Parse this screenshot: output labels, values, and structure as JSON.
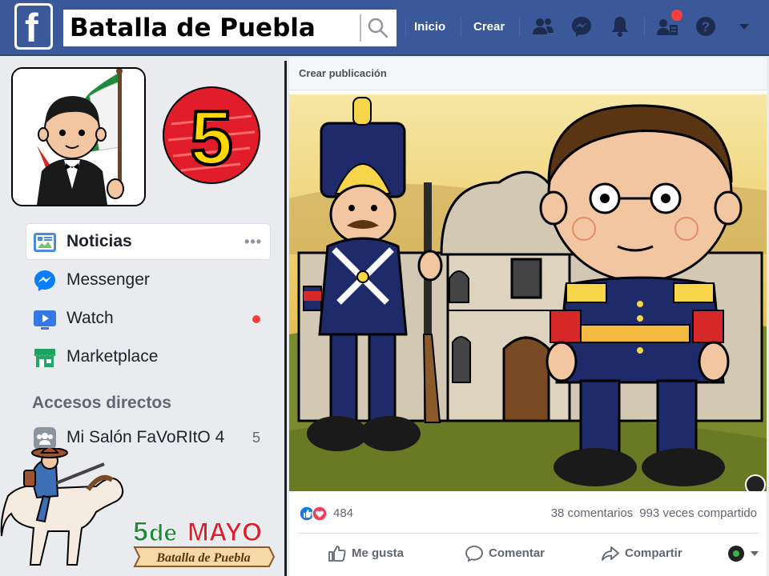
{
  "header": {
    "search_value": "Batalla de Puebla",
    "nav": {
      "home": "Inicio",
      "create": "Crear"
    }
  },
  "sidebar": {
    "items": [
      {
        "label": "Noticias",
        "icon": "news-feed-icon",
        "active": true,
        "more": "•••"
      },
      {
        "label": "Messenger",
        "icon": "messenger-icon"
      },
      {
        "label": "Watch",
        "icon": "watch-icon",
        "has_dot": true
      },
      {
        "label": "Marketplace",
        "icon": "marketplace-icon"
      }
    ],
    "section_title": "Accesos directos",
    "shortcuts": [
      {
        "label": "Mi Salón FaVoRItO 4",
        "count": "5",
        "icon": "group-icon"
      }
    ],
    "badge_number": "5"
  },
  "post": {
    "header_label": "Crear publicación",
    "reactions_count": "484",
    "comments": "38 comentarios",
    "shares": "993 veces compartido",
    "actions": {
      "like": "Me gusta",
      "comment": "Comentar",
      "share": "Compartir"
    }
  },
  "colors": {
    "brand": "#3b5998",
    "notification": "#fa3e3e",
    "background": "#e9ebee"
  }
}
